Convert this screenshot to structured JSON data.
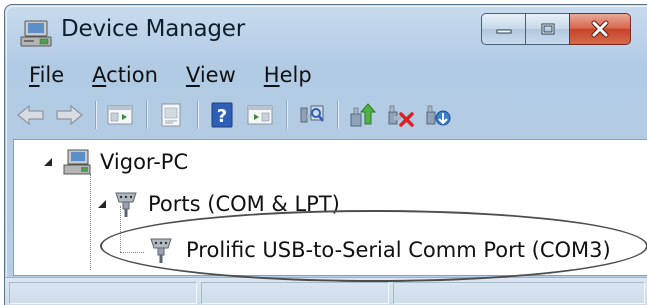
{
  "window": {
    "title": "Device Manager"
  },
  "menu": {
    "items": [
      {
        "label": "File",
        "mnemonic": "F",
        "rest": "ile"
      },
      {
        "label": "Action",
        "mnemonic": "A",
        "rest": "ction"
      },
      {
        "label": "View",
        "mnemonic": "V",
        "rest": "iew"
      },
      {
        "label": "Help",
        "mnemonic": "H",
        "rest": "elp"
      }
    ]
  },
  "toolbar": {
    "buttons": [
      "back-icon",
      "forward-icon",
      "show-hide-console-tree-icon",
      "properties-icon",
      "help-icon",
      "show-action-pane-icon",
      "scan-hardware-icon",
      "update-driver-icon",
      "disable-device-icon",
      "uninstall-device-icon"
    ]
  },
  "tree": {
    "root": "Vigor-PC",
    "category": "Ports (COM & LPT)",
    "device": "Prolific USB-to-Serial Comm Port (COM3)"
  },
  "colors": {
    "close_button": "#c7432a",
    "titlebar": "#c9dcee"
  }
}
